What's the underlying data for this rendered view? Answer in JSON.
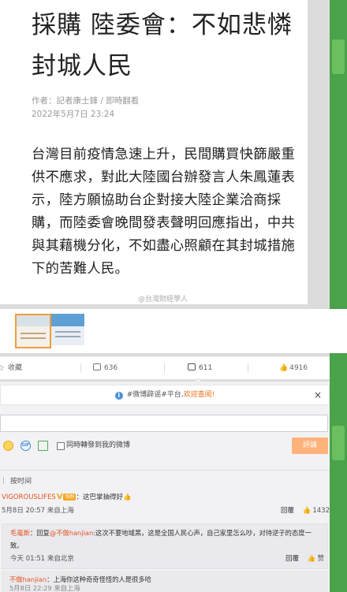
{
  "article": {
    "title": "採購 陸委會：不如悲憐封城人民",
    "author": "作者：記者康士鋒 / 即時翻看",
    "date": "2022年5月7日 23:24",
    "body": "台灣目前疫情急速上升，民間購買快篩嚴重供不應求，對此大陸國台辦發言人朱鳳蓮表示，陸方願協助台企對接大陸企業洽商採購，而陸委會晚間發表聲明回應指出，中共與其藉機分化，不如盡心照顧在其封城措施下的苦難人民。",
    "watermark": "@台灣財經學人"
  },
  "actions": {
    "favorite_label": "收藏",
    "repost_count": "636",
    "comment_count": "611",
    "like_count": "4916"
  },
  "notice": {
    "text": "#微博辟谣#平台,",
    "link": "欢迎查阅!",
    "close": "×"
  },
  "composer": {
    "repost_label": "同時轉發到我的微博",
    "submit_label": "評論"
  },
  "sort_label": "按时间",
  "comments": [
    {
      "user": "VIGOROUSLIFES",
      "level_badge": "铁粉",
      "text": "：这巴掌抽得好",
      "time": "5月8日 20:57 来自上海",
      "reply_label": "回覆",
      "likes": "1432"
    }
  ],
  "replies": [
    {
      "user": "毛毫斯",
      "prefix": "：回复",
      "mention": "@不做hanjian",
      "text": ":这次不要地域黑，这是全国人民心声，自己家里怎么吵，对待逆子的态度一致。",
      "time": "今天 01:51 来自北京",
      "reply_label": "回覆",
      "like_label": "赞"
    },
    {
      "user": "不做hanjian",
      "text": "：上海你这种奇奇怪怪的人是很多哈",
      "time": "5月8日 22:29 来自上海"
    }
  ],
  "colors": {
    "accent": "#e86c13",
    "user": "#e8531f",
    "sidebar": "#4aa24a"
  }
}
